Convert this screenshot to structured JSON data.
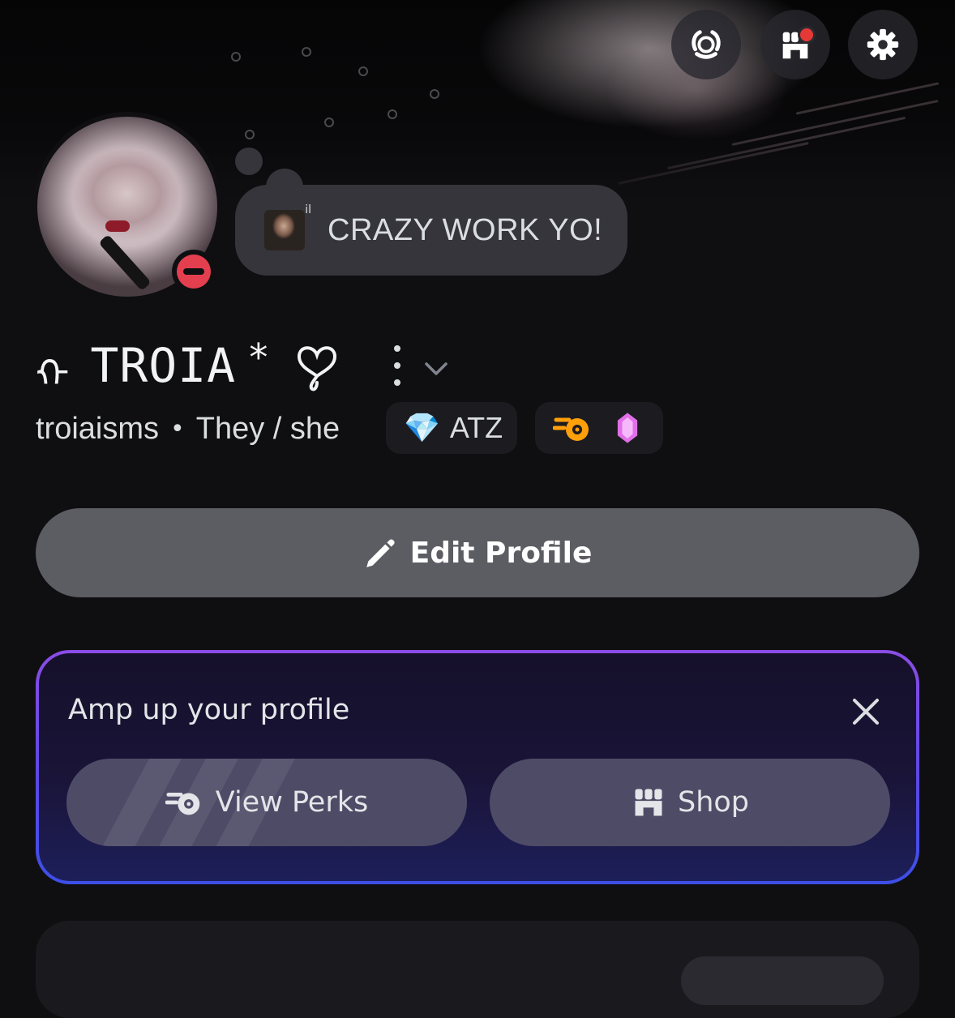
{
  "header": {
    "nitro_button_icon": "laurel-badge-icon",
    "shop_button_icon": "shop-icon",
    "settings_button_icon": "gear-icon"
  },
  "status": {
    "text": "CRAZY WORK YO!",
    "emoji": "custom-photo-emoji"
  },
  "profile": {
    "name_prefix": "ᡣ",
    "display_name": "TROIA",
    "name_suffix": "*",
    "username": "troiaisms",
    "separator": "•",
    "pronouns": "They / she",
    "presence": "do-not-disturb"
  },
  "server_tag": {
    "emoji": "💎",
    "label": "ATZ"
  },
  "badges": [
    "nitro-badge-icon",
    "boost-gem-icon"
  ],
  "edit_profile": {
    "label": "Edit Profile"
  },
  "amp_card": {
    "title": "Amp up your profile",
    "perks_label": "View Perks",
    "shop_label": "Shop"
  },
  "colors": {
    "background": "#0f0f11",
    "button": "#5c5c63",
    "dnd": "#e43f4f",
    "accent_purple": "#8b4ce6",
    "accent_blue": "#3d4fe8"
  }
}
